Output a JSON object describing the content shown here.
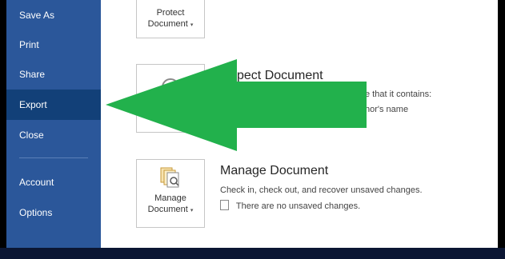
{
  "sidebar": {
    "items": [
      {
        "label": "Save As"
      },
      {
        "label": "Print"
      },
      {
        "label": "Share"
      },
      {
        "label": "Export"
      },
      {
        "label": "Close"
      },
      {
        "label": "Account"
      },
      {
        "label": "Options"
      }
    ],
    "active_item": "Export"
  },
  "protect": {
    "button_line1": "Protect",
    "button_line2": "Document"
  },
  "inspect": {
    "title_partial": "pect Document",
    "desc_line1_partial": "e that it contains:",
    "desc_line2_partial": "hor's name"
  },
  "manage": {
    "button_line1": "Manage",
    "button_line2": "Document",
    "title": "Manage Document",
    "description": "Check in, check out, and recover unsaved changes.",
    "status": "There are no unsaved changes."
  },
  "overlay": {
    "arrow_color": "#22b14c",
    "icon": "arrow-left-icon"
  },
  "colors": {
    "sidebar_bg": "#2b579a",
    "sidebar_active": "#124078"
  }
}
